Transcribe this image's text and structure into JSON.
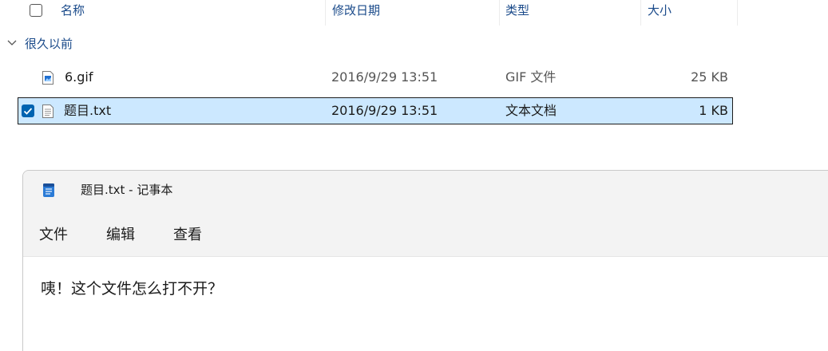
{
  "explorer": {
    "columns": {
      "name": "名称",
      "modified": "修改日期",
      "type": "类型",
      "size": "大小"
    },
    "group": {
      "label": "很久以前"
    },
    "files": [
      {
        "name": "6.gif",
        "modified": "2016/9/29 13:51",
        "type": "GIF 文件",
        "size": "25 KB",
        "icon": "image-file-icon",
        "selected": false
      },
      {
        "name": "题目.txt",
        "modified": "2016/9/29 13:51",
        "type": "文本文档",
        "size": "1 KB",
        "icon": "text-file-icon",
        "selected": true
      }
    ],
    "accent_color": "#0063b1",
    "selection_color": "#cce8ff"
  },
  "notepad": {
    "title": "题目.txt - 记事本",
    "menu": [
      "文件",
      "编辑",
      "查看"
    ],
    "content": "咦！这个文件怎么打不开？"
  }
}
